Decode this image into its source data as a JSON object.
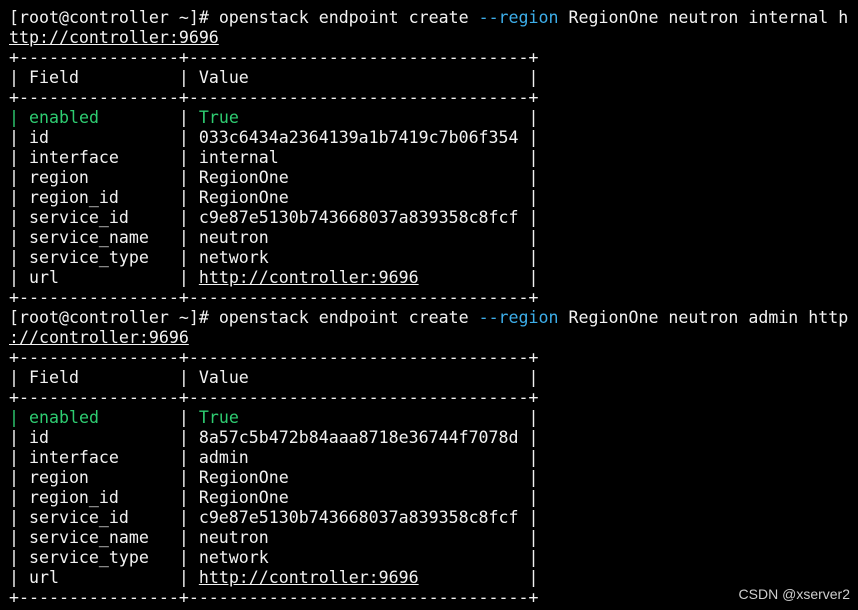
{
  "terminal": {
    "commands": [
      {
        "prompt": "[root@controller ~]#",
        "cmd_prefix": "openstack endpoint create",
        "option": "--region",
        "cmd_args": "RegionOne neutron internal h",
        "url_wrap": "ttp://controller:9696",
        "table": {
          "border": "+----------------+----------------------------------+",
          "header": {
            "field": "Field",
            "value": "Value"
          },
          "rows": [
            {
              "field": "enabled",
              "value": "True",
              "highlight": true
            },
            {
              "field": "id",
              "value": "033c6434a2364139a1b7419c7b06f354"
            },
            {
              "field": "interface",
              "value": "internal"
            },
            {
              "field": "region",
              "value": "RegionOne"
            },
            {
              "field": "region_id",
              "value": "RegionOne"
            },
            {
              "field": "service_id",
              "value": "c9e87e5130b743668037a839358c8fcf"
            },
            {
              "field": "service_name",
              "value": "neutron"
            },
            {
              "field": "service_type",
              "value": "network"
            },
            {
              "field": "url",
              "value": "http://controller:9696",
              "link": true
            }
          ]
        }
      },
      {
        "prompt": "[root@controller ~]#",
        "cmd_prefix": "openstack endpoint create",
        "option": "--region",
        "cmd_args": "RegionOne neutron admin http",
        "url_wrap": "://controller:9696",
        "table": {
          "border": "+----------------+----------------------------------+",
          "header": {
            "field": "Field",
            "value": "Value"
          },
          "rows": [
            {
              "field": "enabled",
              "value": "True",
              "highlight": true
            },
            {
              "field": "id",
              "value": "8a57c5b472b84aaa8718e36744f7078d"
            },
            {
              "field": "interface",
              "value": "admin"
            },
            {
              "field": "region",
              "value": "RegionOne"
            },
            {
              "field": "region_id",
              "value": "RegionOne"
            },
            {
              "field": "service_id",
              "value": "c9e87e5130b743668037a839358c8fcf"
            },
            {
              "field": "service_name",
              "value": "neutron"
            },
            {
              "field": "service_type",
              "value": "network"
            },
            {
              "field": "url",
              "value": "http://controller:9696",
              "link": true
            }
          ]
        }
      }
    ]
  },
  "watermark": "CSDN @xserver2",
  "colors": {
    "background": "#000000",
    "text": "#f2f2f2",
    "option": "#3daee9",
    "highlight": "#2ecc71"
  }
}
